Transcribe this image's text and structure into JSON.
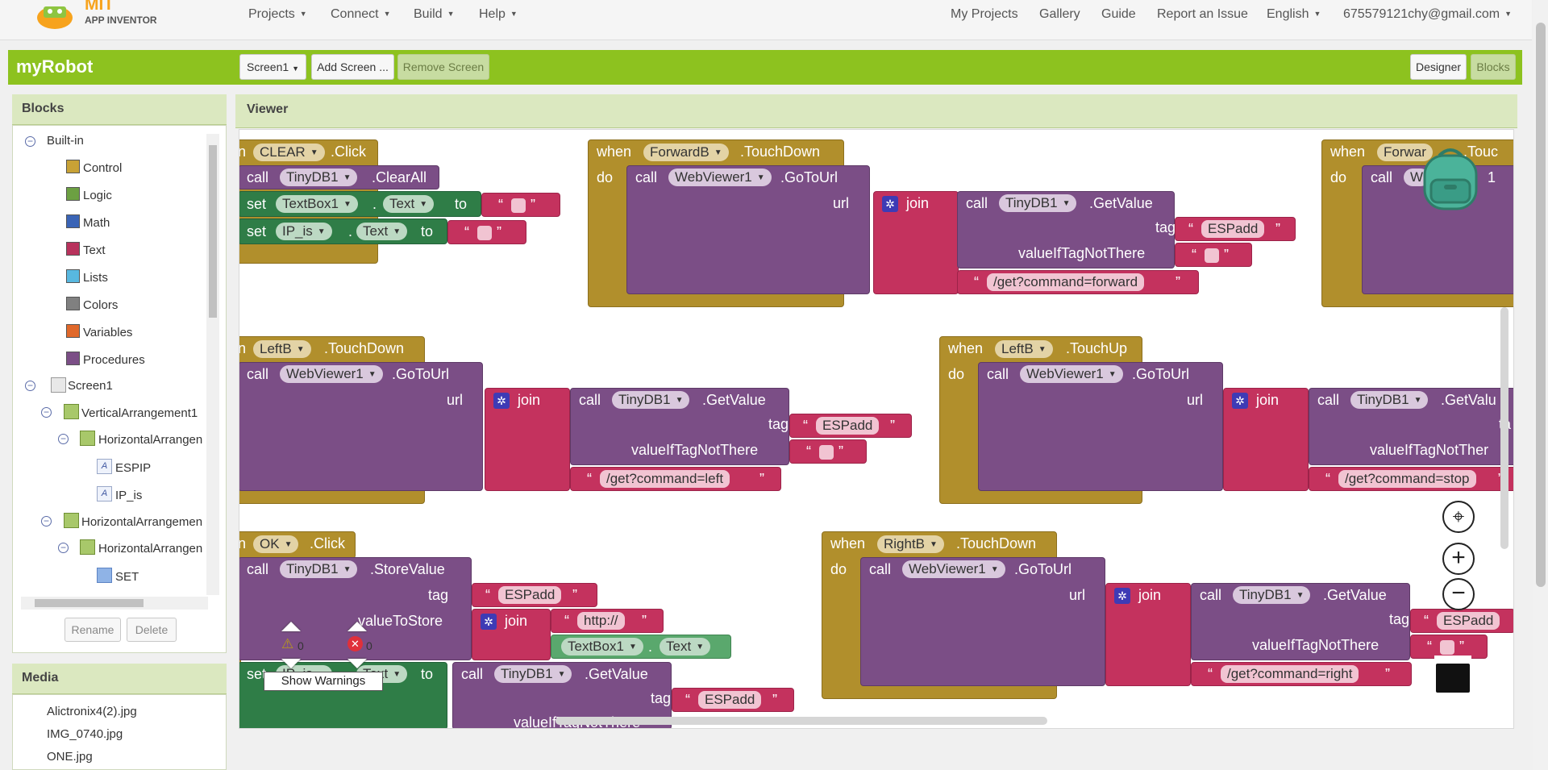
{
  "top_nav": {
    "logo_mit": "MIT",
    "logo_sub": "APP INVENTOR",
    "menus": [
      "Projects",
      "Connect",
      "Build",
      "Help"
    ],
    "right_links": [
      "My Projects",
      "Gallery",
      "Guide",
      "Report an Issue"
    ],
    "language": "English",
    "account": "675579121chy@gmail.com"
  },
  "project_bar": {
    "name": "myRobot",
    "screen_select": "Screen1",
    "add_screen": "Add Screen ...",
    "remove_screen": "Remove Screen",
    "designer": "Designer",
    "blocks": "Blocks"
  },
  "blocks_panel": {
    "title": "Blocks",
    "builtin_label": "Built-in",
    "builtin_items": [
      {
        "label": "Control",
        "color": "#c8a236"
      },
      {
        "label": "Logic",
        "color": "#6ca042"
      },
      {
        "label": "Math",
        "color": "#3a64b6"
      },
      {
        "label": "Text",
        "color": "#b8325c"
      },
      {
        "label": "Lists",
        "color": "#58b8e0"
      },
      {
        "label": "Colors",
        "color": "#808080"
      },
      {
        "label": "Variables",
        "color": "#e0682a"
      },
      {
        "label": "Procedures",
        "color": "#7b4e86"
      }
    ],
    "screen": "Screen1",
    "components": [
      {
        "label": "VerticalArrangement1"
      },
      {
        "label": "HorizontalArrangen"
      },
      {
        "label": "ESPIP"
      },
      {
        "label": "IP_is"
      },
      {
        "label": "HorizontalArrangemen"
      },
      {
        "label": "HorizontalArrangen"
      },
      {
        "label": "SET"
      }
    ],
    "rename": "Rename",
    "delete": "Delete"
  },
  "media_panel": {
    "title": "Media",
    "files": [
      "Alictronix4(2).jpg",
      "IMG_0740.jpg",
      "ONE.jpg"
    ]
  },
  "viewer": {
    "title": "Viewer",
    "warnings_count": "0",
    "errors_count": "0",
    "show_warnings": "Show Warnings"
  },
  "blocks": {
    "kw_when": "when",
    "kw_do": "do",
    "kw_call": "call",
    "kw_set": "set",
    "kw_to": "to",
    "kw_url": "url",
    "kw_join": "join",
    "kw_tag": "tag",
    "kw_valueIfTagNotThere": "valueIfTagNotThere",
    "kw_valueToStore": "valueToStore",
    "kw_n": "n",
    "dot": ".",
    "clear_btn": "CLEAR",
    "click": ".Click",
    "tinydb": "TinyDB1",
    "clearall": ".ClearAll",
    "textbox1": "TextBox1",
    "text_prop": "Text",
    "ip_is": "IP_is",
    "forwardb": "ForwardB",
    "forwar_trunc": "Forwar",
    "touchdown": ".TouchDown",
    "touch_trunc": ".Touc",
    "touchup": ".TouchUp",
    "webviewer": "WebViewer1",
    "webviewer_trunc": "W",
    "webviewer_suffix": "1",
    "gotourl": ".GoToUrl",
    "getvalue": ".GetValue",
    "getvalu_trunc": ".GetValu",
    "ta_trunc": "ta",
    "valueiftag_trunc": "valueIfTagNotTher",
    "espadd": "ESPadd",
    "cmd_forward": "/get?command=forward",
    "cmd_left": "/get?command=left",
    "cmd_stop": "/get?command=stop",
    "cmd_right": "/get?command=right",
    "leftb": "LeftB",
    "rightb": "RightB",
    "ok_btn": "OK",
    "storevalue": ".StoreValue",
    "http": "http://",
    "valueiftag_cut": "valueIfTagNotThere"
  }
}
